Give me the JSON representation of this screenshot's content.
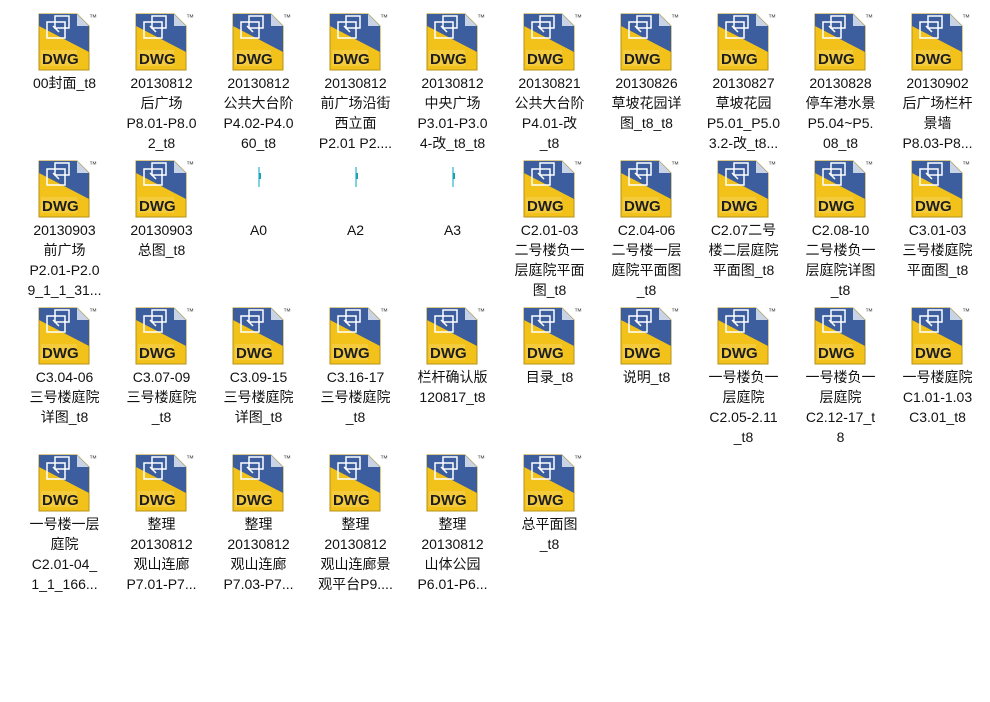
{
  "files": [
    {
      "label": "00封面_t8",
      "type": "dwg"
    },
    {
      "label": "20130812\n后广场\nP8.01-P8.0\n2_t8",
      "type": "dwg"
    },
    {
      "label": "20130812\n公共大台阶\nP4.02-P4.0\n60_t8",
      "type": "dwg"
    },
    {
      "label": "20130812\n前广场沿街\n西立面\nP2.01 P2....",
      "type": "dwg"
    },
    {
      "label": "20130812\n中央广场\nP3.01-P3.0\n4-改_t8_t8",
      "type": "dwg"
    },
    {
      "label": "20130821\n公共大台阶\nP4.01-改\n_t8",
      "type": "dwg"
    },
    {
      "label": "20130826\n草坡花园详\n图_t8_t8",
      "type": "dwg"
    },
    {
      "label": "20130827\n草坡花园\nP5.01_P5.0\n3.2-改_t8...",
      "type": "dwg"
    },
    {
      "label": "20130828\n停车港水景\nP5.04~P5.\n08_t8",
      "type": "dwg"
    },
    {
      "label": "20130902\n后广场栏杆\n景墙\nP8.03-P8...",
      "type": "dwg"
    },
    {
      "label": "20130903\n前广场\nP2.01-P2.0\n9_1_1_31...",
      "type": "dwg"
    },
    {
      "label": "20130903\n总图_t8",
      "type": "dwg"
    },
    {
      "label": "A0",
      "type": "blank"
    },
    {
      "label": "A2",
      "type": "blank"
    },
    {
      "label": "A3",
      "type": "blank"
    },
    {
      "label": "C2.01-03\n二号楼负一\n层庭院平面\n图_t8",
      "type": "dwg"
    },
    {
      "label": "C2.04-06\n二号楼一层\n庭院平面图\n_t8",
      "type": "dwg"
    },
    {
      "label": "C2.07二号\n楼二层庭院\n平面图_t8",
      "type": "dwg"
    },
    {
      "label": "C2.08-10\n二号楼负一\n层庭院详图\n_t8",
      "type": "dwg"
    },
    {
      "label": "C3.01-03\n三号楼庭院\n平面图_t8",
      "type": "dwg"
    },
    {
      "label": "C3.04-06\n三号楼庭院\n详图_t8",
      "type": "dwg"
    },
    {
      "label": "C3.07-09\n三号楼庭院\n_t8",
      "type": "dwg"
    },
    {
      "label": "C3.09-15\n三号楼庭院\n详图_t8",
      "type": "dwg"
    },
    {
      "label": "C3.16-17\n三号楼庭院\n_t8",
      "type": "dwg"
    },
    {
      "label": "栏杆确认版\n120817_t8",
      "type": "dwg"
    },
    {
      "label": "目录_t8",
      "type": "dwg"
    },
    {
      "label": "说明_t8",
      "type": "dwg"
    },
    {
      "label": "一号楼负一\n层庭院\nC2.05-2.11\n_t8",
      "type": "dwg"
    },
    {
      "label": "一号楼负一\n层庭院\nC2.12-17_t\n8",
      "type": "dwg"
    },
    {
      "label": "一号楼庭院\nC1.01-1.03\nC3.01_t8",
      "type": "dwg"
    },
    {
      "label": "一号楼一层\n庭院\nC2.01-04_\n1_1_166...",
      "type": "dwg"
    },
    {
      "label": "整理\n20130812\n观山连廊\nP7.01-P7...",
      "type": "dwg"
    },
    {
      "label": "整理\n20130812\n观山连廊\nP7.03-P7...",
      "type": "dwg"
    },
    {
      "label": "整理\n20130812\n观山连廊景\n观平台P9....",
      "type": "dwg"
    },
    {
      "label": "整理\n20130812\n山体公园\nP6.01-P6...",
      "type": "dwg"
    },
    {
      "label": "总平面图\n_t8",
      "type": "dwg"
    }
  ],
  "icon": {
    "badge_text": "DWG",
    "tm_text": "™",
    "colors": {
      "yellow": "#f2c21b",
      "blue": "#3d5e9e",
      "white": "#ffffff",
      "text": "#111111"
    }
  }
}
